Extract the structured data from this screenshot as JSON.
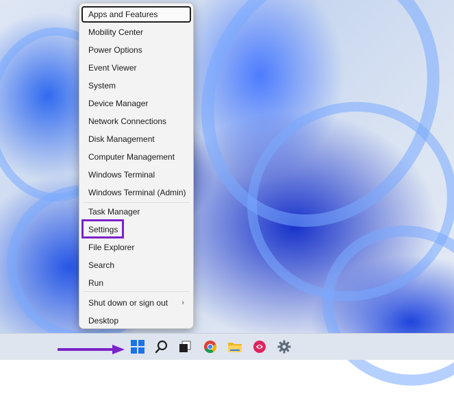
{
  "menu": {
    "items": [
      {
        "label": "Apps and Features"
      },
      {
        "label": "Mobility Center"
      },
      {
        "label": "Power Options"
      },
      {
        "label": "Event Viewer"
      },
      {
        "label": "System"
      },
      {
        "label": "Device Manager"
      },
      {
        "label": "Network Connections"
      },
      {
        "label": "Disk Management"
      },
      {
        "label": "Computer Management"
      },
      {
        "label": "Windows Terminal"
      },
      {
        "label": "Windows Terminal (Admin)"
      },
      {
        "label": "Task Manager"
      },
      {
        "label": "Settings"
      },
      {
        "label": "File Explorer"
      },
      {
        "label": "Search"
      },
      {
        "label": "Run"
      },
      {
        "label": "Shut down or sign out",
        "submenu_icon": "chevron-right-icon"
      },
      {
        "label": "Desktop"
      }
    ],
    "submenu_arrow": "›"
  },
  "annotation": {
    "highlight_color": "#7b22c9",
    "arrow_color": "#7b22c9"
  },
  "taskbar": {
    "icons": [
      "windows-start-icon",
      "search-icon",
      "task-view-icon",
      "chrome-icon",
      "file-explorer-icon",
      "app-icon",
      "settings-icon"
    ]
  }
}
